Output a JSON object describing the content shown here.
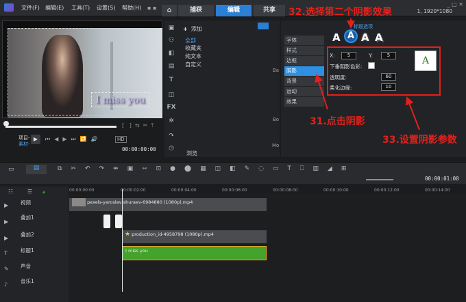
{
  "menu": [
    "文件(F)",
    "编辑(E)",
    "工具(T)",
    "设置(S)",
    "帮助(H)"
  ],
  "workspace_tabs": {
    "home": "⌂",
    "capture": "捕获",
    "edit": "编辑",
    "share": "共享"
  },
  "resolution": "1, 1920*1080",
  "annotations": {
    "step32": "32.选择第二个阴影效果",
    "step31": "31.点击阴影",
    "step33": "33.设置阴影参数"
  },
  "preview": {
    "overlay_text": "I miss you",
    "labels": {
      "project": "项目-",
      "clip": "素材-"
    },
    "timecode": "00:00:00:00",
    "hd_badge": "HD"
  },
  "library": {
    "add_label": "添加",
    "items": [
      "全部",
      "收藏夹",
      "纯文本",
      "自定义"
    ],
    "browse_label": "浏览",
    "side_letters": [
      "Ba",
      "Bo",
      "Mo"
    ]
  },
  "options": {
    "title_options_label": "标题选项",
    "tabs": [
      "字体",
      "样式",
      "边框",
      "阴影",
      "背景",
      "运动",
      "效果"
    ],
    "active_tab": "阴影",
    "shadow_styles": [
      "A",
      "A",
      "A",
      "A"
    ],
    "x_label": "X:",
    "x_value": "5",
    "y_label": "Y:",
    "y_value": "5",
    "drop_shadow_color_label": "下垂阴影色彩:",
    "opacity_label": "透明度:",
    "opacity_value": "60",
    "softness_label": "柔化边缘:",
    "softness_value": "10",
    "preview_letter": "A"
  },
  "timeline": {
    "timecode": "00:00:01:00",
    "ruler": [
      "00:00:00:00",
      "00:00:02:00",
      "00:00:04:00",
      "00:00:06:00",
      "00:00:08:00",
      "00:00:10:00",
      "00:00:12:00",
      "00:00:14:00"
    ],
    "tracks": [
      "视频",
      "叠加1",
      "叠加2",
      "标题1",
      "声音",
      "音乐1"
    ],
    "clips": {
      "video": "pexels-yaroslav-shuraev-6984880 (1080p).mp4",
      "overlay2": "production_id-4958798 (1080p).mp4",
      "title": "I miss you"
    }
  },
  "colors": {
    "accent": "#2b7fd4",
    "annotation_red": "#e3211c",
    "title_clip": "#44a32b"
  }
}
